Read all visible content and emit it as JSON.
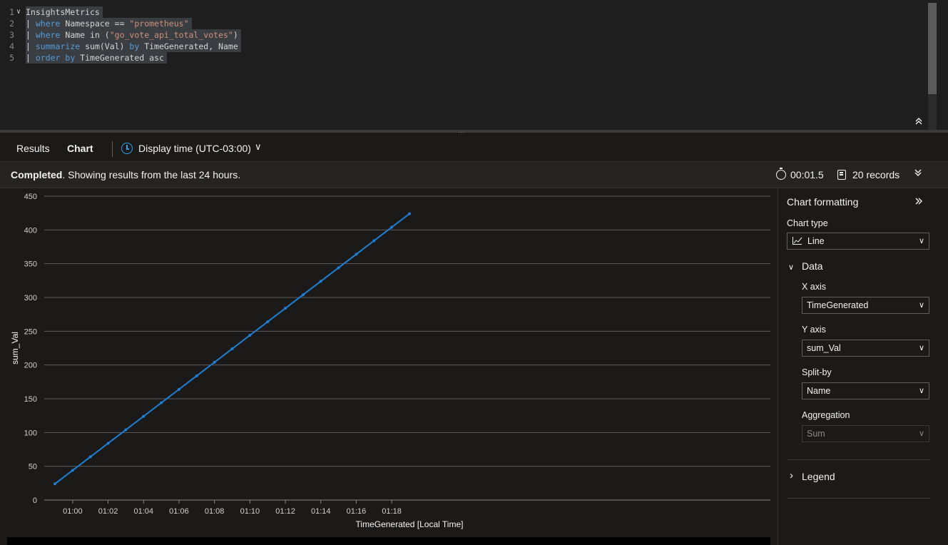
{
  "editor": {
    "lines": [
      {
        "num": "1",
        "fold": "∨",
        "parts": [
          {
            "cls": "id",
            "text": "InsightsMetrics"
          }
        ]
      },
      {
        "num": "2",
        "parts": [
          {
            "cls": "id",
            "text": "| "
          },
          {
            "cls": "kw",
            "text": "where"
          },
          {
            "cls": "id",
            "text": " Namespace == "
          },
          {
            "cls": "str",
            "text": "\"prometheus\""
          }
        ]
      },
      {
        "num": "3",
        "parts": [
          {
            "cls": "id",
            "text": "| "
          },
          {
            "cls": "kw",
            "text": "where"
          },
          {
            "cls": "id",
            "text": " Name in ("
          },
          {
            "cls": "str",
            "text": "\"go_vote_api_total_votes\""
          },
          {
            "cls": "id",
            "text": ")"
          }
        ]
      },
      {
        "num": "4",
        "parts": [
          {
            "cls": "id",
            "text": "| "
          },
          {
            "cls": "kw",
            "text": "summarize"
          },
          {
            "cls": "id",
            "text": " sum(Val) "
          },
          {
            "cls": "kw",
            "text": "by"
          },
          {
            "cls": "id",
            "text": " TimeGenerated, Name"
          }
        ]
      },
      {
        "num": "5",
        "parts": [
          {
            "cls": "id",
            "text": "| "
          },
          {
            "cls": "kw",
            "text": "order by"
          },
          {
            "cls": "id",
            "text": " TimeGenerated asc"
          }
        ]
      }
    ],
    "collapse_icon": "double-chevron-up-icon",
    "splitter_grip": "···"
  },
  "tabs": {
    "results": "Results",
    "chart": "Chart",
    "display_time": "Display time (UTC-03:00)",
    "display_time_chevron": "∨"
  },
  "status": {
    "strong": "Completed",
    "text": ". Showing results from the last 24 hours.",
    "elapsed": "00:01.5",
    "records": "20 records",
    "expand_icon": "»"
  },
  "chart_data": {
    "type": "line",
    "title": "",
    "xlabel": "TimeGenerated [Local Time]",
    "ylabel": "sum_Val",
    "x_tick_labels": [
      "01:00",
      "01:02",
      "01:04",
      "01:06",
      "01:08",
      "01:10",
      "01:12",
      "01:14",
      "01:16",
      "01:18"
    ],
    "y_ticks": [
      0,
      50,
      100,
      150,
      200,
      250,
      300,
      350,
      400,
      450
    ],
    "ylim": [
      0,
      450
    ],
    "grid": true,
    "color": "#1f7fd4",
    "series": [
      {
        "x": [
          "00:59",
          "01:00",
          "01:01",
          "01:02",
          "01:03",
          "01:04",
          "01:05",
          "01:06",
          "01:07",
          "01:08",
          "01:09",
          "01:10",
          "01:11",
          "01:12",
          "01:13",
          "01:14",
          "01:15",
          "01:16",
          "01:17",
          "01:18",
          "01:19"
        ],
        "values": [
          24,
          44,
          64,
          84,
          104,
          124,
          144,
          164,
          184,
          204,
          224,
          244,
          264,
          284,
          304,
          324,
          344,
          364,
          384,
          404,
          424
        ]
      }
    ]
  },
  "panel": {
    "title": "Chart formatting",
    "collapse_icon": "»",
    "chart_type_label": "Chart type",
    "chart_type_value": "Line",
    "data_section": "Data",
    "x_axis_label": "X axis",
    "x_axis_value": "TimeGenerated",
    "y_axis_label": "Y axis",
    "y_axis_value": "sum_Val",
    "split_label": "Split-by",
    "split_value": "Name",
    "aggregation_label": "Aggregation",
    "aggregation_value": "Sum",
    "legend_section": "Legend",
    "dropdown_chevron": "∨",
    "expanded_chevron": "∨",
    "collapsed_chevron": "›"
  }
}
